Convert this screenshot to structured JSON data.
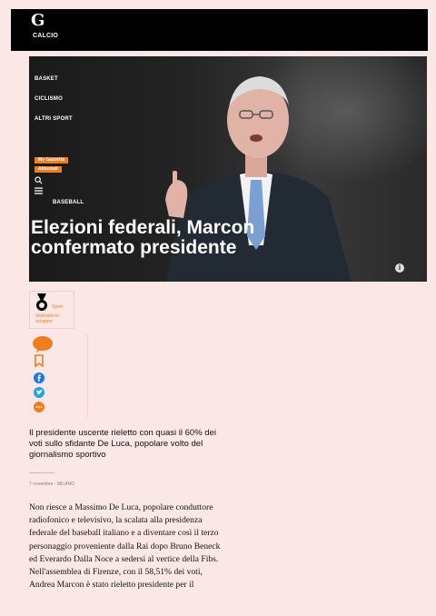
{
  "header": {
    "logo": "G",
    "nav_top": "CALCIO"
  },
  "hero": {
    "nav": [
      "BASKET",
      "CICLISMO",
      "ALTRI SPORT"
    ],
    "badges": [
      "My Gazzetta",
      "Abbonati"
    ],
    "nav_bottom": "BASEBALL",
    "title": "Elezioni federali, Marcon confermato presidente"
  },
  "sport_box": {
    "label": "Sport",
    "link": "Vedi tutto lo sciopero"
  },
  "article": {
    "lede": "Il presidente uscente rieletto con quasi il 60% dei voti sullo sfidante De Luca, popolare volto del giornalismo sportivo",
    "dateline": "7 novembre - MILANO",
    "body": "Non riesce a Massimo De Luca, popolare conduttore radiofonico e televisivo, la scalata alla presidenza federale del baseball italiano e a diventare così il terzo personaggio proveniente dalla Rai dopo Bruno Beneck ed Everardo Dalla Noce a sedersi al vertice della Fibs. Nell'assemblea di Firenze, con il 58,51% dei voti, Andrea Marcon è stato rieletto presidente per il"
  },
  "colors": {
    "page_bg": "#fbe7e5",
    "accent": "#f07d1e",
    "facebook": "#1877f2",
    "twitter": "#1da1f2"
  },
  "icons": [
    "search-icon",
    "menu-icon",
    "info-icon",
    "medal-icon",
    "comment-icon",
    "bookmark-icon",
    "facebook-icon",
    "twitter-icon",
    "more-icon"
  ]
}
